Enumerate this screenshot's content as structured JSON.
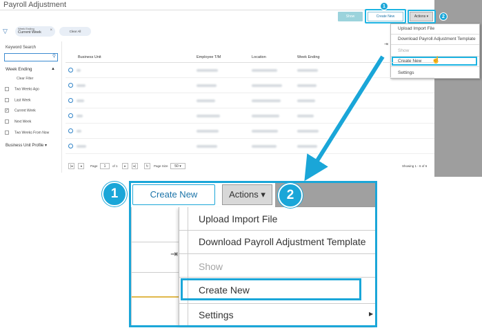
{
  "app": {
    "title": "Payroll Adjustment",
    "toolbar": {
      "show_label": "Show",
      "create_new_label": "Create New",
      "actions_label": "Actions ▾"
    },
    "callout_numbers": [
      "1",
      "2"
    ],
    "actions_menu": {
      "items": [
        {
          "label": "Upload Import File"
        },
        {
          "label": "Download Payroll Adjustment Template"
        },
        {
          "label": "Show",
          "disabled": true
        },
        {
          "label": "Create New",
          "highlighted": true
        },
        {
          "label": "Settings",
          "has_submenu": true
        }
      ]
    },
    "filter_chip": {
      "caption": "Week Ending",
      "value": "Current Week",
      "remove": "×"
    },
    "clear_all_label": "Clear All",
    "sidebar": {
      "keyword_search_label": "Keyword Search",
      "week_ending_label": "Week Ending",
      "clear_label": "Clear Filter",
      "options": [
        {
          "label": "Two Weeks Ago",
          "checked": false
        },
        {
          "label": "Last Week",
          "checked": false
        },
        {
          "label": "Current Week",
          "checked": true
        },
        {
          "label": "Next Week",
          "checked": false
        },
        {
          "label": "Two Weeks From Now",
          "checked": false
        }
      ],
      "business_unit_profile_label": "Business Unit Profile"
    },
    "grid": {
      "columns": [
        "Business Unit",
        "Employee T/M",
        "Location",
        "Week Ending"
      ],
      "row_count_visible": 6
    },
    "pager": {
      "page_label": "Page",
      "page_value": "1",
      "of_label": "of 1",
      "page_size_label": "Page Size",
      "page_size_value": "50",
      "showing": "Showing 1 - 6 of 6"
    }
  },
  "zoom": {
    "create_new_label": "Create New",
    "actions_label": "Actions",
    "menu_items": [
      {
        "label": "Upload Import File"
      },
      {
        "label": "Download Payroll Adjustment Template"
      },
      {
        "label": "Show",
        "disabled": true
      },
      {
        "label": "Create New",
        "highlighted": true
      },
      {
        "label": "Settings",
        "has_submenu": true
      }
    ],
    "badge_1": "1",
    "badge_2": "2"
  },
  "colors": {
    "callout_blue": "#1aa6d8",
    "link_blue": "#1a73a8",
    "show_button": "#9cd3dc",
    "gray_panel": "#a0a0a0"
  }
}
